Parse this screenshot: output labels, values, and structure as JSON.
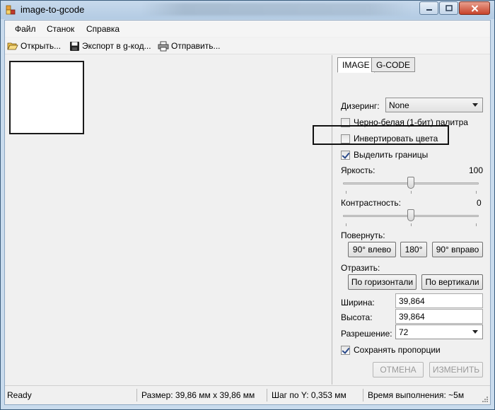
{
  "window": {
    "title": "image-to-gcode"
  },
  "menu": {
    "items": [
      "Файл",
      "Станок",
      "Справка"
    ]
  },
  "toolbar": {
    "open_label": "Открыть...",
    "export_label": "Экспорт в g-код...",
    "send_label": "Отправить..."
  },
  "panel": {
    "tabs": [
      "IMAGE",
      "G-CODE"
    ],
    "active_tab": "IMAGE",
    "dithering_label": "Дизеринг:",
    "dithering_value": "None",
    "bw_palette_label": "Черно-белая (1-бит) палитра",
    "bw_palette_checked": false,
    "invert_label": "Инвертировать цвета",
    "invert_checked": false,
    "edges_label": "Выделить границы",
    "edges_checked": true,
    "brightness_label": "Яркость:",
    "brightness_value": "100",
    "brightness_level": 0.5,
    "contrast_label": "Контрастность:",
    "contrast_value": "0",
    "contrast_level": 0.5,
    "rotate_label": "Повернуть:",
    "rotate_left": "90° влево",
    "rotate_180": "180°",
    "rotate_right": "90° вправо",
    "mirror_label": "Отразить:",
    "mirror_h": "По горизонтали",
    "mirror_v": "По вертикали",
    "width_label": "Ширина:",
    "width_value": "39,864",
    "height_label": "Высота:",
    "height_value": "39,864",
    "resolution_label": "Разрешение:",
    "resolution_value": "72",
    "keep_ratio_label": "Сохранять пропорции",
    "keep_ratio_checked": true,
    "cancel_label": "ОТМЕНА",
    "apply_label": "ИЗМЕНИТЬ"
  },
  "status": {
    "state": "Ready",
    "size": "Размер: 39,86 мм x 39,86 мм",
    "step": "Шаг по Y: 0,353 мм",
    "time": "Время выполнения: ~5м"
  }
}
